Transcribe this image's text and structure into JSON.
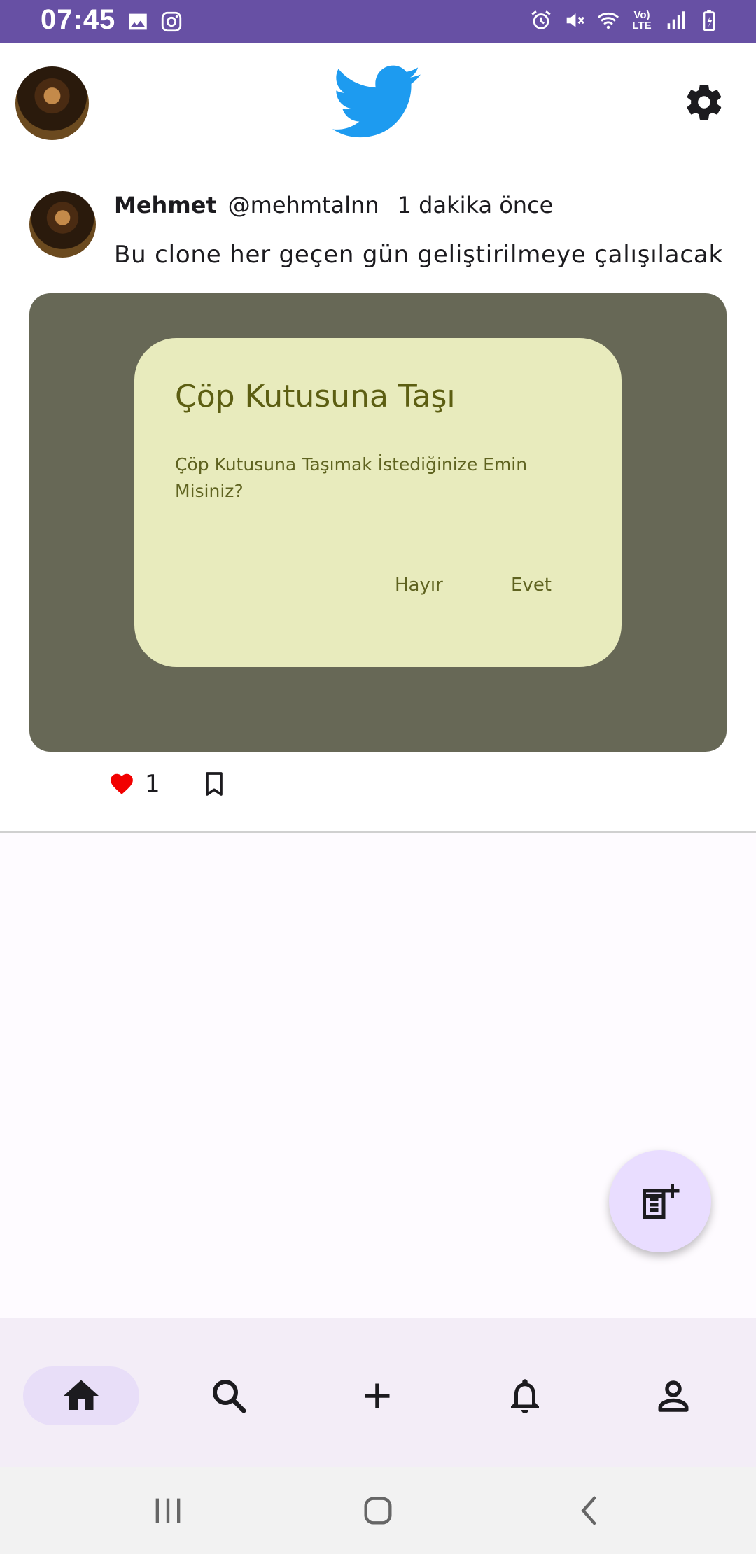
{
  "status_bar": {
    "time": "07:45",
    "network_label": "Vo) LTE",
    "left_icons": [
      "gallery-icon",
      "instagram-icon"
    ],
    "right_icons": [
      "alarm-icon",
      "mute-icon",
      "wifi-icon",
      "volte-icon",
      "signal-icon",
      "battery-icon"
    ]
  },
  "top_bar": {
    "logo": "twitter-bird-icon",
    "settings_icon": "gear-icon"
  },
  "tweet": {
    "name": "Mehmet",
    "handle": "@mehmtalnn",
    "time": "1 dakika önce",
    "text": "Bu clone her geçen gün geliştirilmeye çalışılacak",
    "image": {
      "dialog_title": "Çöp Kutusuna Taşı",
      "dialog_body": "Çöp Kutusuna Taşımak İstediğinize Emin Misiniz?",
      "dialog_no": "Hayır",
      "dialog_yes": "Evet"
    },
    "like_count": "1",
    "liked": true
  },
  "fab": {
    "icon": "new-post-icon"
  },
  "bottom_nav": {
    "items": [
      "home-icon",
      "search-icon",
      "add-icon",
      "notifications-icon",
      "profile-icon"
    ],
    "selected": "home"
  },
  "colors": {
    "status_bar": "#6750a4",
    "twitter_blue": "#1d9bf0",
    "like_red": "#f20000",
    "image_bg": "#676856",
    "dialog_bg": "#e8ebbd",
    "fab_bg": "#e9ddff",
    "nav_bg": "#f3edf7",
    "nav_pill": "#e8def8"
  }
}
